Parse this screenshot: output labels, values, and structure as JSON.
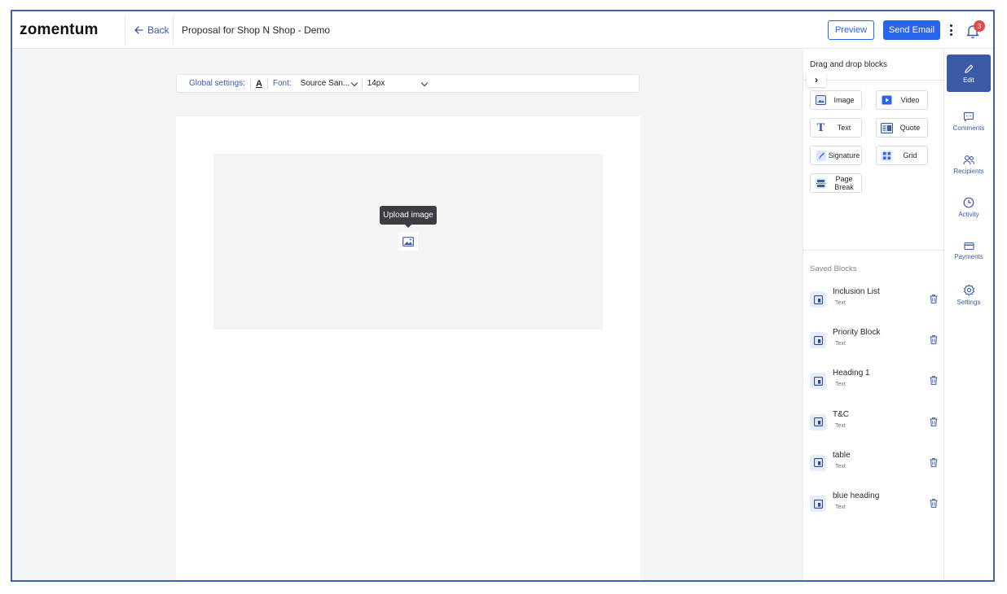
{
  "header": {
    "logo": "zomentum",
    "back_label": "Back",
    "doc_title": "Proposal for Shop N Shop - Demo",
    "preview_label": "Preview",
    "send_label": "Send Email",
    "notification_count": "3"
  },
  "toolbar": {
    "global_settings_label": "Global settings:",
    "font_letter": "A",
    "font_label": "Font:",
    "font_value": "Source San...",
    "size_value": "14px"
  },
  "editor": {
    "tooltip": "Upload image"
  },
  "blocks_panel": {
    "title": "Drag and drop blocks",
    "blocks": [
      {
        "label": "Image",
        "icon": "image-icon"
      },
      {
        "label": "Video",
        "icon": "video-icon"
      },
      {
        "label": "Text",
        "icon": "text-icon"
      },
      {
        "label": "Quote",
        "icon": "quote-icon"
      },
      {
        "label": "Signature",
        "icon": "signature-icon"
      },
      {
        "label": "Grid",
        "icon": "grid-icon"
      },
      {
        "label": "Page Break",
        "icon": "page-break-icon"
      }
    ],
    "saved_title": "Saved Blocks",
    "saved": [
      {
        "name": "Inclusion List",
        "type": "Text"
      },
      {
        "name": "Priority Block",
        "type": "Text"
      },
      {
        "name": "Heading 1",
        "type": "Text"
      },
      {
        "name": "T&C",
        "type": "Text"
      },
      {
        "name": "table",
        "type": "Text"
      },
      {
        "name": "blue heading",
        "type": "Text"
      }
    ]
  },
  "rail": [
    {
      "label": "Edit",
      "icon": "pencil-icon",
      "active": true
    },
    {
      "label": "Comments",
      "icon": "comment-icon"
    },
    {
      "label": "Recipients",
      "icon": "recipients-icon"
    },
    {
      "label": "Activity",
      "icon": "clock-icon"
    },
    {
      "label": "Payments",
      "icon": "card-icon"
    },
    {
      "label": "Settings",
      "icon": "gear-icon"
    }
  ],
  "colors": {
    "accent": "#2a64e8",
    "rail_active": "#3a5aa6",
    "badge": "#e5484d",
    "frame": "#3f62b0"
  }
}
